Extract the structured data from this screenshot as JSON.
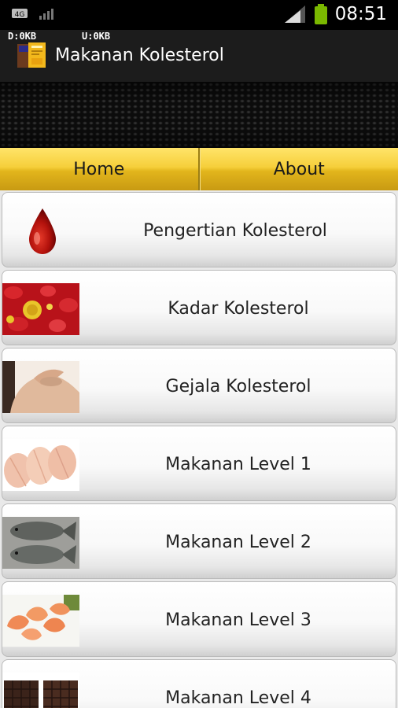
{
  "status_bar": {
    "time": "08:51",
    "network_badge": "4G",
    "icons": [
      "data-badge-icon",
      "weak-signal-icon",
      "signal-strength-icon",
      "battery-icon"
    ]
  },
  "action_bar": {
    "traffic_down": "D:0KB",
    "traffic_up": "U:0KB",
    "title": "Makanan Kolesterol",
    "icon": "app-book-icon"
  },
  "tabs": [
    {
      "label": "Home"
    },
    {
      "label": "About"
    }
  ],
  "menu": {
    "items": [
      {
        "label": "Pengertian Kolesterol",
        "icon": "blood-drop-icon"
      },
      {
        "label": "Kadar Kolesterol",
        "icon": "blood-cells-image"
      },
      {
        "label": "Gejala Kolesterol",
        "icon": "shoulder-pain-image"
      },
      {
        "label": "Makanan Level 1",
        "icon": "chicken-breast-image"
      },
      {
        "label": "Makanan Level 2",
        "icon": "fish-image"
      },
      {
        "label": "Makanan Level 3",
        "icon": "shrimp-image"
      },
      {
        "label": "Makanan Level 4",
        "icon": "chocolate-image"
      }
    ]
  },
  "colors": {
    "tab_gold": "#f6cf3a",
    "action_bar": "#1c1c1c",
    "list_text": "#222222"
  }
}
